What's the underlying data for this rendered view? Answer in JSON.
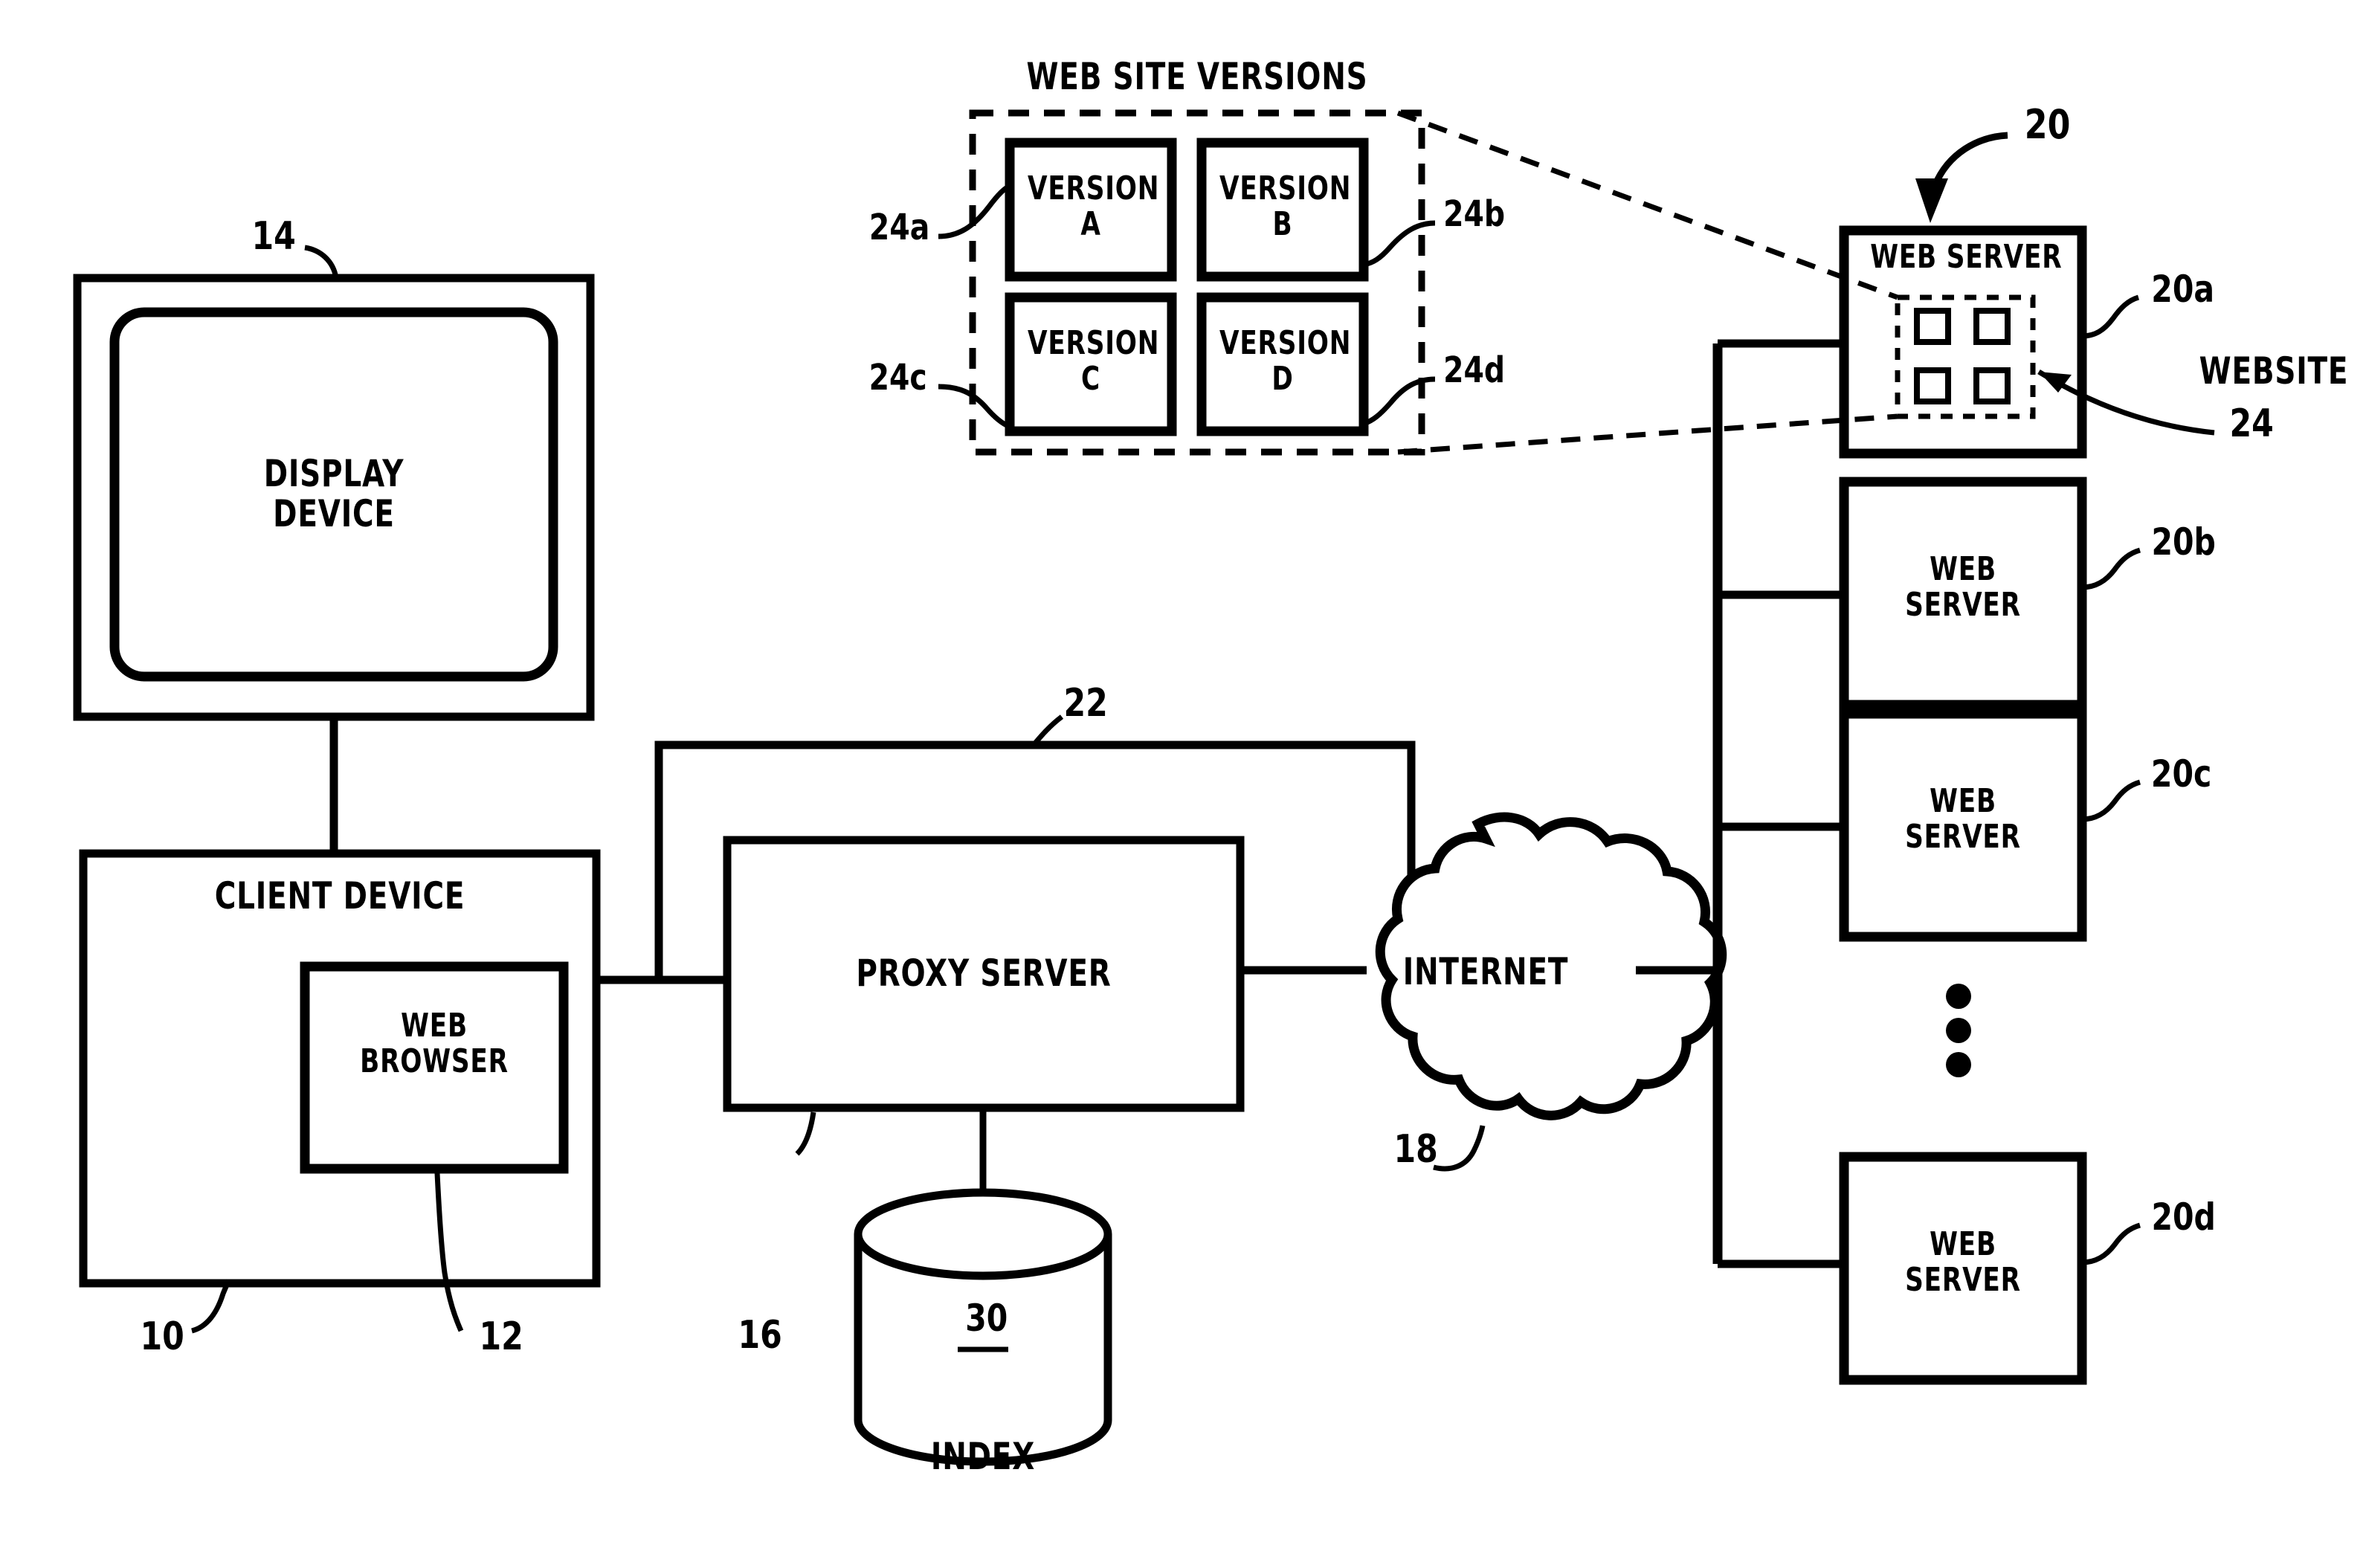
{
  "figure": {
    "type": "patent-block-diagram",
    "title": "WEB SITE VERSIONS"
  },
  "nodes": {
    "display_device": {
      "label": "DISPLAY\nDEVICE",
      "ref": "14"
    },
    "client_device": {
      "label": "CLIENT DEVICE",
      "ref": "10"
    },
    "web_browser": {
      "label": "WEB\nBROWSER",
      "ref": "12"
    },
    "proxy_server": {
      "label": "PROXY SERVER",
      "ref": "16"
    },
    "index_db": {
      "label": "INDEX",
      "ref": "30"
    },
    "internet": {
      "label": "INTERNET",
      "ref": "18"
    },
    "web_server_a": {
      "label": "WEB SERVER",
      "ref": "20a"
    },
    "web_server_b": {
      "label": "WEB\nSERVER",
      "ref": "20b"
    },
    "web_server_c": {
      "label": "WEB\nSERVER",
      "ref": "20c"
    },
    "web_server_d": {
      "label": "WEB\nSERVER",
      "ref": "20d"
    },
    "website_callout": {
      "label": "WEBSITE",
      "ref": "24"
    },
    "server_group": {
      "ref": "20"
    },
    "connection_22": {
      "ref": "22"
    },
    "vertical_dots": "•••"
  },
  "versions_panel": {
    "title": "WEB SITE VERSIONS",
    "items": [
      {
        "label": "VERSION\nA",
        "ref": "24a"
      },
      {
        "label": "VERSION\nB",
        "ref": "24b"
      },
      {
        "label": "VERSION\nC",
        "ref": "24c"
      },
      {
        "label": "VERSION\nD",
        "ref": "24d"
      }
    ]
  },
  "colors": {
    "ink": "#000000",
    "paper": "#ffffff"
  }
}
